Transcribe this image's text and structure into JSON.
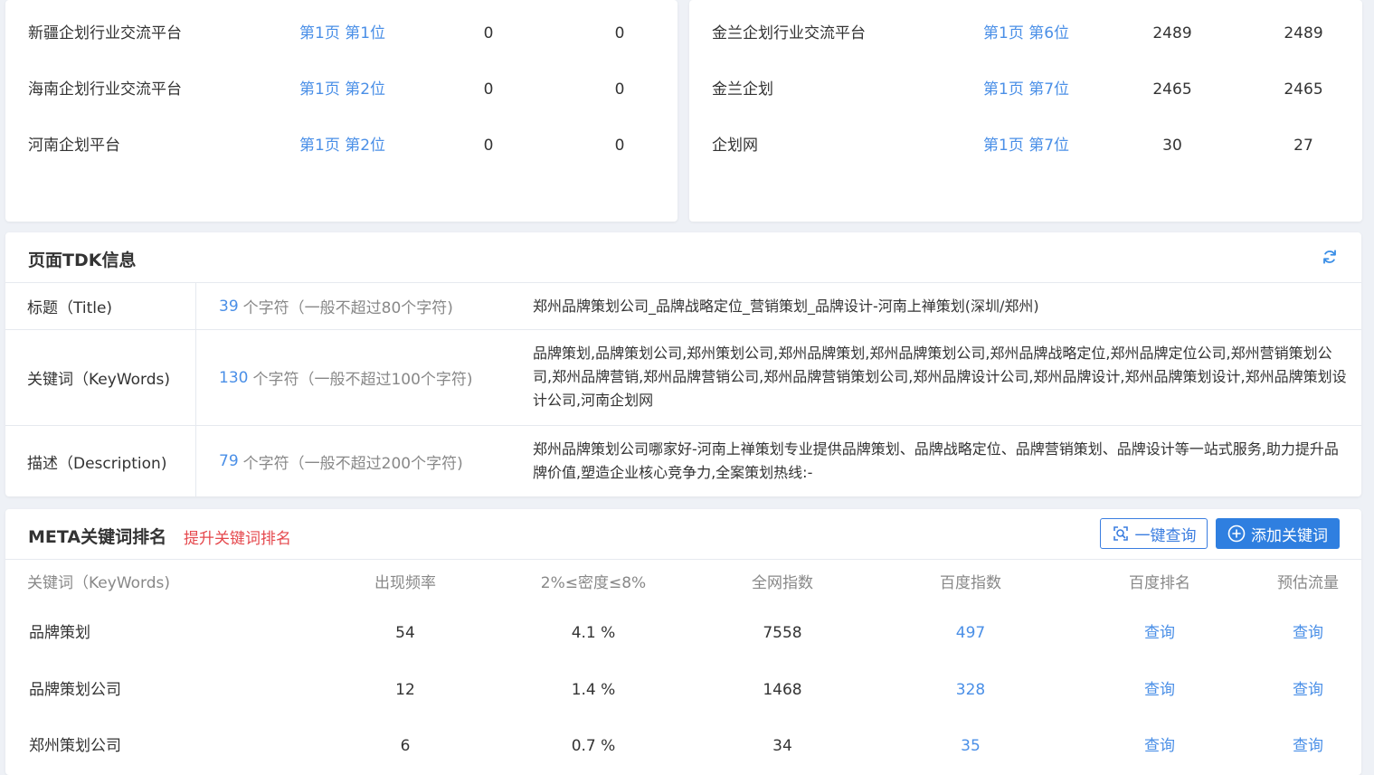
{
  "rank_left": [
    {
      "keyword": "新疆企划行业交流平台",
      "position": "第1页 第1位",
      "v1": "0",
      "v2": "0"
    },
    {
      "keyword": "海南企划行业交流平台",
      "position": "第1页 第2位",
      "v1": "0",
      "v2": "0"
    },
    {
      "keyword": "河南企划平台",
      "position": "第1页 第2位",
      "v1": "0",
      "v2": "0"
    }
  ],
  "rank_right": [
    {
      "keyword": "金兰企划行业交流平台",
      "position": "第1页 第6位",
      "v1": "2489",
      "v2": "2489"
    },
    {
      "keyword": "金兰企划",
      "position": "第1页 第7位",
      "v1": "2465",
      "v2": "2465"
    },
    {
      "keyword": "企划网",
      "position": "第1页 第7位",
      "v1": "30",
      "v2": "27"
    }
  ],
  "tdk": {
    "title": "页面TDK信息",
    "refresh_icon": "refresh-icon",
    "rows": [
      {
        "label": "标题（Title)",
        "count": "39",
        "count_text": "个字符（一般不超过80个字符)",
        "value": "郑州品牌策划公司_品牌战略定位_营销策划_品牌设计-河南上禅策划(深圳/郑州)"
      },
      {
        "label": "关键词（KeyWords)",
        "count": "130",
        "count_text": "个字符（一般不超过100个字符)",
        "value": "品牌策划,品牌策划公司,郑州策划公司,郑州品牌策划,郑州品牌策划公司,郑州品牌战略定位,郑州品牌定位公司,郑州营销策划公司,郑州品牌营销,郑州品牌营销公司,郑州品牌营销策划公司,郑州品牌设计公司,郑州品牌设计,郑州品牌策划设计,郑州品牌策划设计公司,河南企划网"
      },
      {
        "label": "描述（Description)",
        "count": "79",
        "count_text": "个字符（一般不超过200个字符)",
        "value": "郑州品牌策划公司哪家好-河南上禅策划专业提供品牌策划、品牌战略定位、品牌营销策划、品牌设计等一站式服务,助力提升品牌价值,塑造企业核心竞争力,全案策划热线:-"
      }
    ]
  },
  "meta": {
    "title": "META关键词排名",
    "subtitle": "提升关键词排名",
    "query_button": "一键查询",
    "add_button": "添加关键词",
    "headers": [
      "关键词（KeyWords)",
      "出现频率",
      "2%≤密度≤8%",
      "全网指数",
      "百度指数",
      "百度排名",
      "预估流量"
    ],
    "rows": [
      {
        "keyword": "品牌策划",
        "freq": "54",
        "density": "4.1 %",
        "net_index": "7558",
        "baidu_index": "497",
        "baidu_rank": "查询",
        "traffic": "查询"
      },
      {
        "keyword": "品牌策划公司",
        "freq": "12",
        "density": "1.4 %",
        "net_index": "1468",
        "baidu_index": "328",
        "baidu_rank": "查询",
        "traffic": "查询"
      },
      {
        "keyword": "郑州策划公司",
        "freq": "6",
        "density": "0.7 %",
        "net_index": "34",
        "baidu_index": "35",
        "baidu_rank": "查询",
        "traffic": "查询"
      }
    ]
  },
  "colors": {
    "link": "#4a8fe7",
    "accent": "#2f7fe0",
    "danger": "#e5484d",
    "background": "#eef1f6"
  }
}
